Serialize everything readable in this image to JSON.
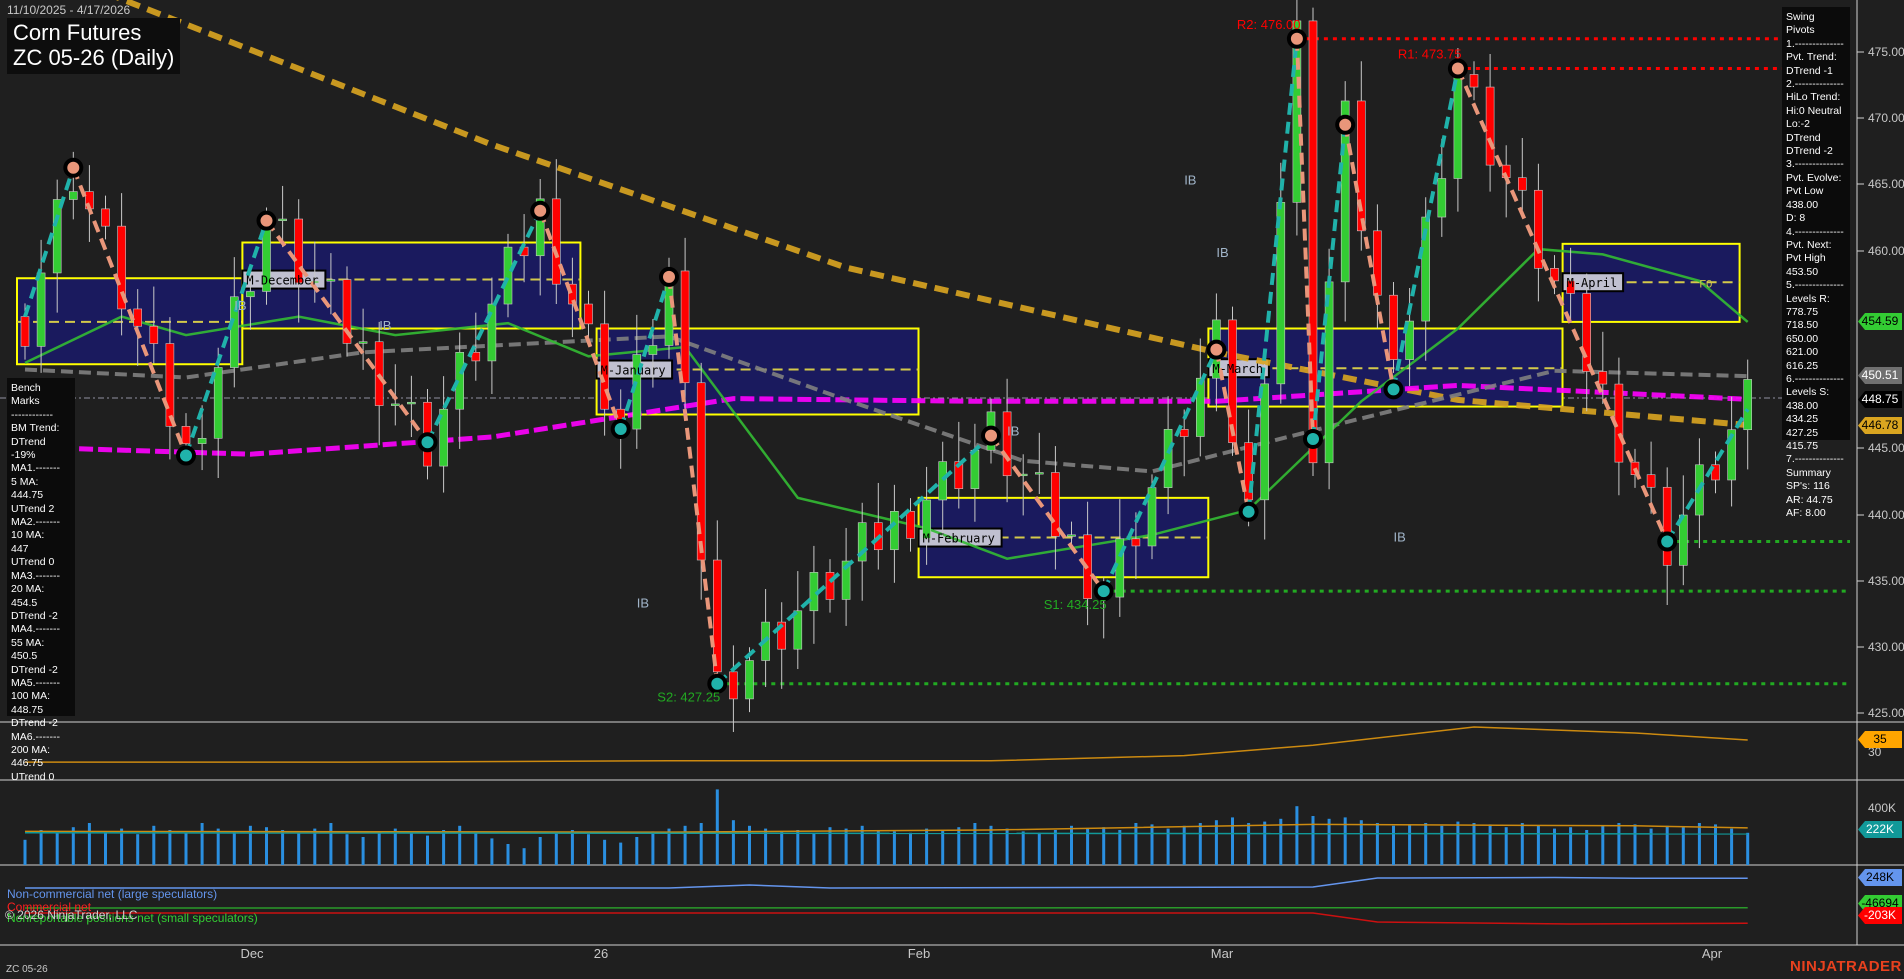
{
  "header": {
    "date_range": "11/10/2025 - 4/17/2026",
    "title_line1": "Corn Futures",
    "title_line2": "ZC 05-26 (Daily)"
  },
  "bench_marks": [
    "Bench Marks",
    "------------",
    "BM Trend:",
    "DTrend -19%",
    "MA1.-------",
    "5 MA:",
    "444.75",
    "UTrend 2",
    "MA2.-------",
    "10 MA:",
    "447",
    "UTrend 0",
    "MA3.-------",
    "20 MA:",
    "454.5",
    "DTrend -2",
    "MA4.-------",
    "55 MA:",
    "450.5",
    "DTrend -2",
    "MA5.-------",
    "100 MA:",
    "448.75",
    "DTrend -2",
    "MA6.-------",
    "200 MA:",
    "446.75",
    "UTrend 0"
  ],
  "swing_pivots": [
    "Swing Pivots",
    "1.--------------",
    "Pvt. Trend:",
    "DTrend -1",
    "2.--------------",
    "HiLo Trend:",
    "Hi:0 Neutral",
    "Lo:-2 DTrend",
    "DTrend -2",
    "3.--------------",
    "Pvt. Evolve:",
    "Pvt Low",
    "438.00",
    "D: 8",
    "4.--------------",
    "Pvt. Next:",
    "Pvt High",
    "453.50",
    "5.--------------",
    "Levels R:",
    "778.75",
    "718.50",
    "650.00",
    "621.00",
    "616.25",
    "6.--------------",
    "Levels S:",
    "438.00",
    "434.25",
    "427.25",
    "415.75",
    "7.--------------",
    "Summary",
    "SP's: 116",
    "AR: 44.75",
    "AF: 8.00"
  ],
  "price_axis": [
    "475.00",
    "470.00",
    "465.00",
    "460.00",
    "445.00",
    "440.00",
    "435.00",
    "430.00",
    "425.00"
  ],
  "price_tags": [
    {
      "text": "454.59",
      "bg": "#33cc33",
      "fg": "#000000"
    },
    {
      "text": "450.51",
      "bg": "#707070",
      "fg": "#ffffff"
    },
    {
      "text": "448.75",
      "bg": "#000000",
      "fg": "#ffffff"
    },
    {
      "text": "446.78",
      "bg": "#daa520",
      "fg": "#000000"
    }
  ],
  "adx_axis": "30",
  "adx_tag": {
    "text": "35",
    "bg": "#ffa500",
    "fg": "#000000"
  },
  "volume_axis": "400K",
  "volume_tag": {
    "text": "222K",
    "bg": "#119999",
    "fg": "#ffffff"
  },
  "cot_tags": [
    {
      "text": "248K",
      "bg": "#6495ed",
      "fg": "#000000"
    },
    {
      "text": "-46694",
      "bg": "#33cc33",
      "fg": "#000000"
    },
    {
      "text": "-203K",
      "bg": "#ff0000",
      "fg": "#ffffff"
    }
  ],
  "x_axis": [
    "Dec",
    "26",
    "Feb",
    "Mar",
    "Apr"
  ],
  "legend": {
    "noncommercial": "Non-commercial net (large speculators)",
    "commercial": "Commercial net",
    "copyright": "© 2026 NinjaTrader, LLC",
    "nonreportable": "Nonreportable positions net (small speculators)"
  },
  "footer_symbol": "ZC 05-26",
  "logo": "NINJATRADER",
  "colors": {
    "up": "#33cc33",
    "down": "#ff0000",
    "up_leg": "#20b2aa",
    "down_leg": "#e9967a",
    "ma20": "#33bb33",
    "ma55": "#808080",
    "ma100": "#ff00ff",
    "ma200": "#daa520",
    "box_fill": "#1a1a5e",
    "box_edge": "#ffff00"
  },
  "chart_data": {
    "type": "candlestick",
    "title": "Corn Futures ZC 05-26 (Daily)",
    "ylim": [
      424,
      479
    ],
    "bars": 108,
    "x_tick_bars": [
      14,
      36,
      56,
      74,
      96
    ],
    "swing_pivots": [
      [
        0,
        455
      ],
      [
        3,
        466.25
      ],
      [
        10,
        444.5
      ],
      [
        15,
        462.25
      ],
      [
        25,
        445.5
      ],
      [
        32,
        463
      ],
      [
        37,
        446.5
      ],
      [
        40,
        458
      ],
      [
        43,
        427.25
      ],
      [
        60,
        446
      ],
      [
        67,
        434.25
      ],
      [
        74,
        452.5
      ],
      [
        76,
        440.25
      ],
      [
        79,
        476
      ],
      [
        80,
        445.75
      ],
      [
        82,
        469.5
      ],
      [
        85,
        449.5
      ],
      [
        89,
        473.75
      ],
      [
        102,
        438
      ],
      [
        107,
        448
      ]
    ],
    "levels": [
      {
        "label": "R2: 476.00",
        "price": 476.0,
        "from": 79,
        "color": "#ff0000"
      },
      {
        "label": "R1: 473.75",
        "price": 473.75,
        "from": 89,
        "color": "#ff0000"
      },
      {
        "label": "S1: 434.25",
        "price": 434.25,
        "from": 67,
        "color": "#22aa22"
      },
      {
        "label": "S2: 427.25",
        "price": 427.25,
        "from": 43,
        "color": "#22aa22"
      },
      {
        "label": "",
        "price": 438.0,
        "from": 102,
        "color": "#22aa22"
      }
    ],
    "month_boxes": [
      {
        "label": "",
        "from": 0,
        "to": 13,
        "high": 457.9,
        "low": 451.4,
        "mid": 454.6
      },
      {
        "label": "M-December",
        "from": 14,
        "to": 34,
        "high": 460.6,
        "low": 454.1,
        "mid": 457.8
      },
      {
        "label": "M-January",
        "from": 36,
        "to": 55,
        "high": 454.1,
        "low": 447.6,
        "mid": 451.0
      },
      {
        "label": "M-February",
        "from": 56,
        "to": 73,
        "high": 441.3,
        "low": 435.3,
        "mid": 438.3
      },
      {
        "label": "M-March",
        "from": 74,
        "to": 95,
        "high": 454.1,
        "low": 448.2,
        "mid": 451.1
      },
      {
        "label": "M-April",
        "from": 96,
        "to": 106,
        "high": 460.5,
        "low": 454.6,
        "mid": 457.6
      }
    ],
    "box_extra_label": {
      "text": "F0",
      "bar": 104,
      "price": 457.5
    },
    "ib_marks": [
      [
        13,
        455.5
      ],
      [
        22,
        454
      ],
      [
        38,
        433
      ],
      [
        72,
        465
      ],
      [
        74,
        459.5
      ],
      [
        61,
        446
      ],
      [
        85,
        438
      ]
    ],
    "ib_text": "IB",
    "ma_200": [
      [
        0,
        482
      ],
      [
        6,
        479
      ],
      [
        29,
        468
      ],
      [
        51,
        458.7
      ],
      [
        74,
        452.3
      ],
      [
        89,
        448.7
      ],
      [
        107,
        446.8
      ]
    ],
    "ma_100": [
      [
        1,
        445.1
      ],
      [
        14,
        444.6
      ],
      [
        29,
        445.9
      ],
      [
        44,
        448.8
      ],
      [
        59,
        448.6
      ],
      [
        74,
        448.6
      ],
      [
        89,
        449.8
      ],
      [
        107,
        448.75
      ]
    ],
    "ma_55": [
      [
        0,
        451
      ],
      [
        10,
        450.4
      ],
      [
        21,
        452.3
      ],
      [
        32,
        453
      ],
      [
        40,
        453.5
      ],
      [
        51,
        448.7
      ],
      [
        62,
        444.1
      ],
      [
        70,
        443.3
      ],
      [
        82,
        447
      ],
      [
        95,
        450.9
      ],
      [
        107,
        450.5
      ]
    ],
    "ma_20": [
      [
        0,
        451.5
      ],
      [
        6,
        455
      ],
      [
        10,
        453.6
      ],
      [
        17,
        455
      ],
      [
        23,
        453.6
      ],
      [
        30,
        454.5
      ],
      [
        35,
        452
      ],
      [
        41,
        452.7
      ],
      [
        48,
        441.3
      ],
      [
        56,
        439
      ],
      [
        61,
        436.7
      ],
      [
        70,
        438.5
      ],
      [
        76,
        440.4
      ],
      [
        83,
        448.6
      ],
      [
        89,
        454.1
      ],
      [
        94,
        460.1
      ],
      [
        98,
        459.7
      ],
      [
        104,
        457.7
      ],
      [
        107,
        454.6
      ]
    ],
    "adx": [
      [
        0,
        26.5
      ],
      [
        20,
        26.5
      ],
      [
        40,
        27
      ],
      [
        60,
        27
      ],
      [
        72,
        29
      ],
      [
        80,
        33
      ],
      [
        90,
        40
      ],
      [
        100,
        37.7
      ],
      [
        107,
        35
      ]
    ],
    "volume_k": [
      180,
      250,
      230,
      270,
      300,
      240,
      260,
      220,
      280,
      250,
      230,
      300,
      260,
      240,
      280,
      270,
      250,
      230,
      260,
      300,
      220,
      200,
      240,
      260,
      230,
      210,
      250,
      280,
      240,
      190,
      150,
      120,
      200,
      230,
      250,
      220,
      180,
      160,
      200,
      240,
      260,
      280,
      300,
      540,
      320,
      280,
      260,
      240,
      250,
      230,
      270,
      260,
      280,
      250,
      240,
      230,
      260,
      250,
      270,
      300,
      280,
      260,
      240,
      230,
      250,
      280,
      260,
      270,
      250,
      300,
      290,
      260,
      280,
      300,
      320,
      340,
      300,
      310,
      330,
      420,
      350,
      330,
      340,
      320,
      300,
      280,
      290,
      300,
      280,
      310,
      300,
      290,
      270,
      300,
      280,
      260,
      270,
      250,
      280,
      300,
      290,
      260,
      280,
      270,
      300,
      290,
      260,
      230
    ],
    "cot_noncommercial_k": [
      [
        0,
        150
      ],
      [
        40,
        150
      ],
      [
        45,
        180
      ],
      [
        50,
        150
      ],
      [
        80,
        160
      ],
      [
        84,
        250
      ],
      [
        95,
        255
      ],
      [
        100,
        248
      ],
      [
        107,
        248
      ]
    ],
    "cot_commercial_k": [
      [
        0,
        -100
      ],
      [
        80,
        -100
      ],
      [
        84,
        -190
      ],
      [
        96,
        -210
      ],
      [
        107,
        -203
      ]
    ],
    "cot_nonreportable": [
      [
        0,
        -50000
      ],
      [
        107,
        -46694
      ]
    ]
  }
}
